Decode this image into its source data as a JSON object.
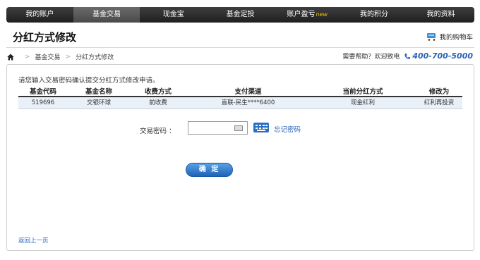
{
  "nav": {
    "items": [
      {
        "label": "我的账户",
        "hot": ""
      },
      {
        "label": "基金交易",
        "hot": ""
      },
      {
        "label": "现金宝",
        "hot": ""
      },
      {
        "label": "基金定投",
        "hot": ""
      },
      {
        "label": "账户盈亏",
        "hot": "new"
      },
      {
        "label": "我的积分",
        "hot": ""
      },
      {
        "label": "我的资料",
        "hot": ""
      }
    ],
    "active_index": 1
  },
  "header": {
    "title": "分红方式修改",
    "cart_label": "我的购物车"
  },
  "breadcrumb": {
    "items": [
      "基金交易",
      "分红方式修改"
    ]
  },
  "help": {
    "text": "需要帮助？欢迎致电",
    "phone": "400-700-5000"
  },
  "form": {
    "intro": "请您输入交易密码确认提交分红方式修改申请。",
    "columns": [
      "基金代码",
      "基金名称",
      "收费方式",
      "支付渠道",
      "当前分红方式",
      "修改为"
    ],
    "rows": [
      [
        "519696",
        "交银环球",
        "前收费",
        "直联-民生****6400",
        "现金红利",
        "红利再投资"
      ]
    ],
    "password_label": "交易密码 ：",
    "password_value": "",
    "forgot_label": "忘记密码",
    "confirm_label": "确 定",
    "back_label": "返回上一页"
  },
  "colors": {
    "nav_bg": "#2b2b2b",
    "accent": "#2a63b8",
    "row_bg": "#e9f0f8"
  },
  "icons": [
    "home-icon",
    "cart-icon",
    "phone-icon",
    "keyboard-icon"
  ]
}
